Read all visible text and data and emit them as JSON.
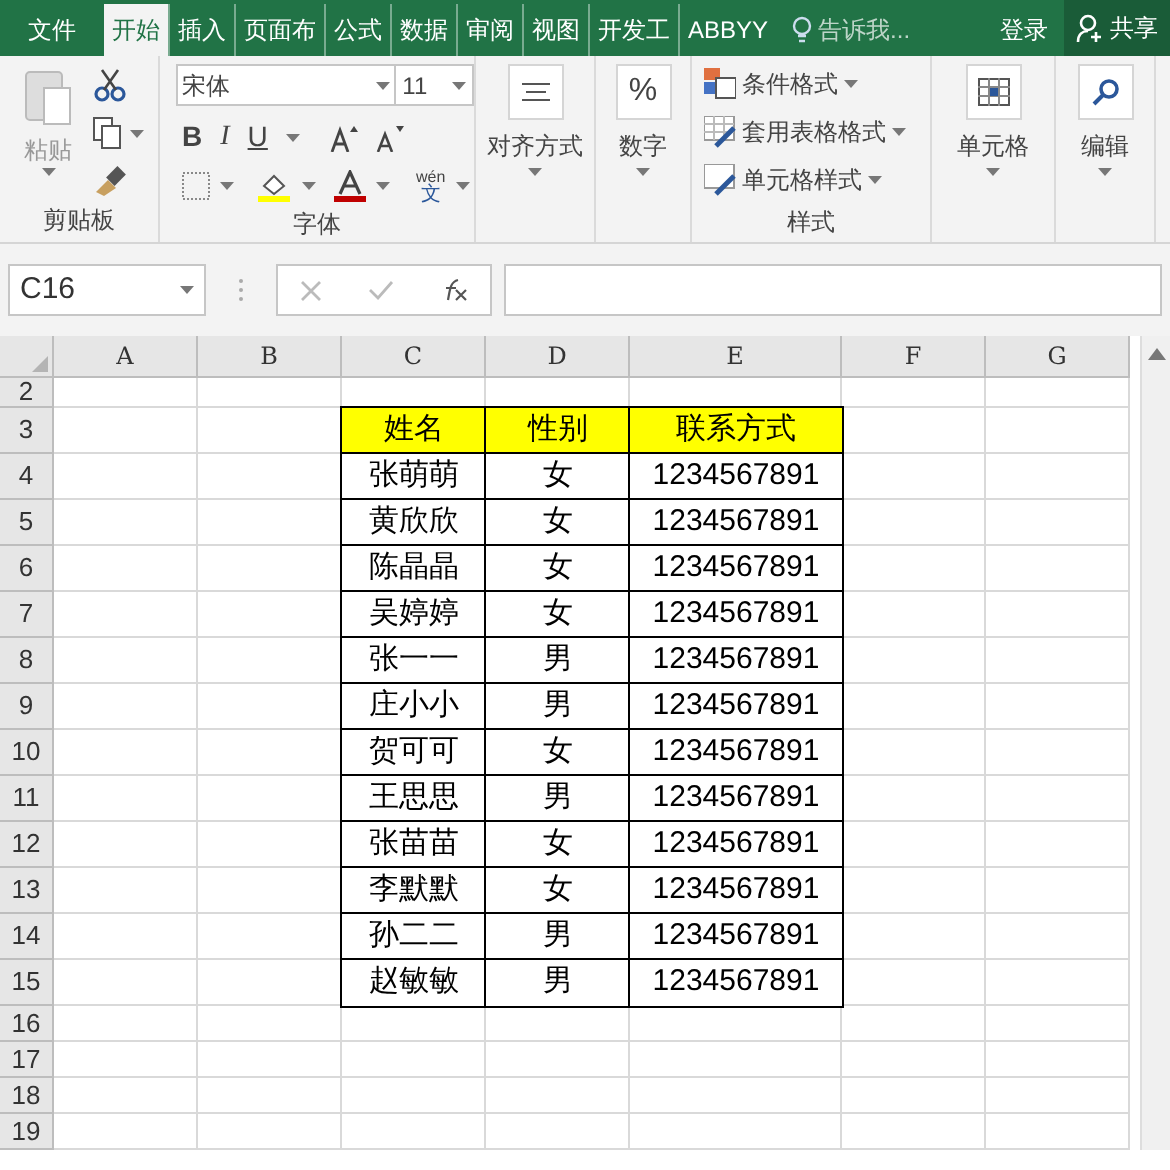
{
  "tabs": [
    {
      "label": "文件",
      "selected": false
    },
    {
      "label": "开始",
      "selected": true
    },
    {
      "label": "插入",
      "selected": false
    },
    {
      "label": "页面布",
      "selected": false
    },
    {
      "label": "公式",
      "selected": false
    },
    {
      "label": "数据",
      "selected": false
    },
    {
      "label": "审阅",
      "selected": false
    },
    {
      "label": "视图",
      "selected": false
    },
    {
      "label": "开发工",
      "selected": false
    },
    {
      "label": "ABBYY",
      "selected": false
    }
  ],
  "tell_me": "告诉我...",
  "sign_in": "登录",
  "share": "共享",
  "ribbon": {
    "clipboard": {
      "paste": "粘贴",
      "label": "剪贴板"
    },
    "font": {
      "name": "宋体",
      "size": "11",
      "phonetic": "wén",
      "phonetic_char": "文",
      "label": "字体",
      "bold": "B",
      "italic": "I",
      "underline": "U"
    },
    "alignment": "对齐方式",
    "number": {
      "symbol": "%",
      "label": "数字"
    },
    "styles": {
      "items": [
        "条件格式",
        "套用表格格式",
        "单元格样式"
      ],
      "label": "样式"
    },
    "cells": "单元格",
    "editing": "编辑"
  },
  "name_box": "C16",
  "sheet": {
    "columns": [
      "A",
      "B",
      "C",
      "D",
      "E",
      "F",
      "G"
    ],
    "row_numbers": [
      "2",
      "3",
      "4",
      "5",
      "6",
      "7",
      "8",
      "9",
      "10",
      "11",
      "12",
      "13",
      "14",
      "15",
      "16",
      "17",
      "18",
      "19"
    ],
    "table": {
      "header": [
        "姓名",
        "性别",
        "联系方式"
      ],
      "rows": [
        [
          "张萌萌",
          "女",
          "1234567891"
        ],
        [
          "黄欣欣",
          "女",
          "1234567891"
        ],
        [
          "陈晶晶",
          "女",
          "1234567891"
        ],
        [
          "吴婷婷",
          "女",
          "1234567891"
        ],
        [
          "张一一",
          "男",
          "1234567891"
        ],
        [
          "庄小小",
          "男",
          "1234567891"
        ],
        [
          "贺可可",
          "女",
          "1234567891"
        ],
        [
          "王思思",
          "男",
          "1234567891"
        ],
        [
          "张苗苗",
          "女",
          "1234567891"
        ],
        [
          "李默默",
          "女",
          "1234567891"
        ],
        [
          "孙二二",
          "男",
          "1234567891"
        ],
        [
          "赵敏敏",
          "男",
          "1234567891"
        ]
      ]
    }
  }
}
